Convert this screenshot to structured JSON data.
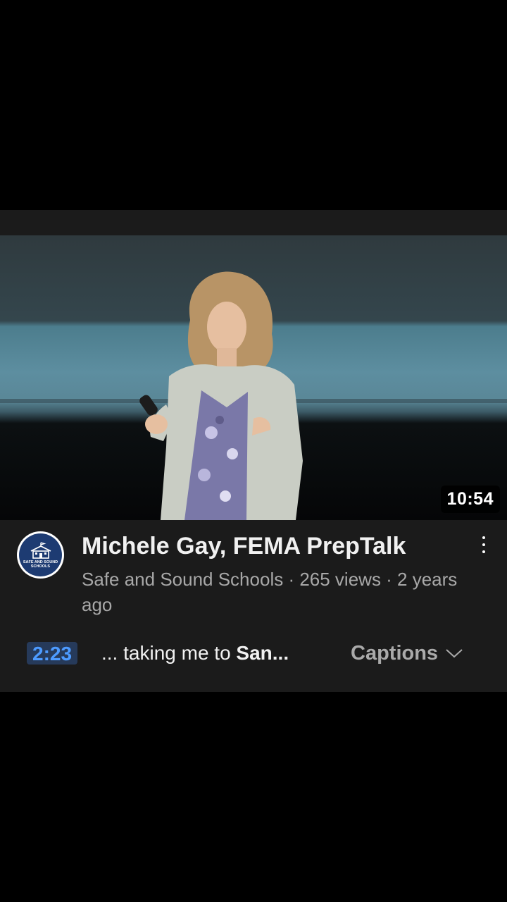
{
  "video": {
    "duration": "10:54",
    "title": "Michele Gay, FEMA PrepTalk",
    "meta": "Safe and Sound Schools · 265 views · 2 years ago"
  },
  "channel": {
    "avatar_text": "SAFE AND SOUND SCHOOLS",
    "avatar_icon": "schoolhouse-icon"
  },
  "transcript_match": {
    "timestamp": "2:23",
    "prefix": "... taking me to ",
    "highlight": "San..."
  },
  "captions_label": "Captions",
  "icons": {
    "more": "more-vertical-icon",
    "chevron": "chevron-down-icon"
  },
  "colors": {
    "card_bg": "#1b1b1b",
    "timestamp_text": "#4d9bff",
    "timestamp_bg": "#263a5a",
    "avatar_bg": "#1d3b72"
  }
}
